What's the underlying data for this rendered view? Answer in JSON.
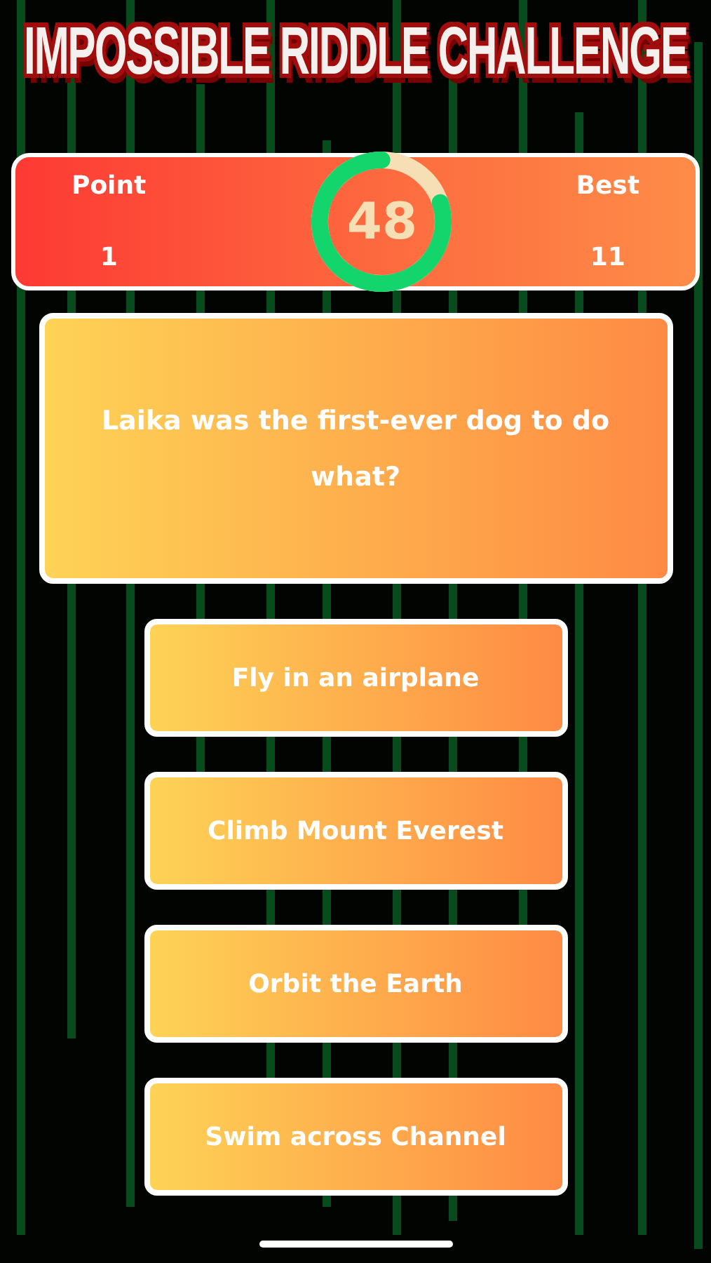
{
  "title": "IMPOSSIBLE RIDDLE CHALLENGE",
  "score": {
    "point_label": "Point",
    "point_value": "1",
    "best_label": "Best",
    "best_value": "11",
    "timer": {
      "value": "48",
      "level": 0.8
    }
  },
  "question": "Laika was the first-ever dog to do what?",
  "answers": [
    {
      "label": "Fly in an airplane"
    },
    {
      "label": "Climb Mount Everest"
    },
    {
      "label": "Orbit the Earth"
    },
    {
      "label": "Swim across Channel"
    }
  ]
}
